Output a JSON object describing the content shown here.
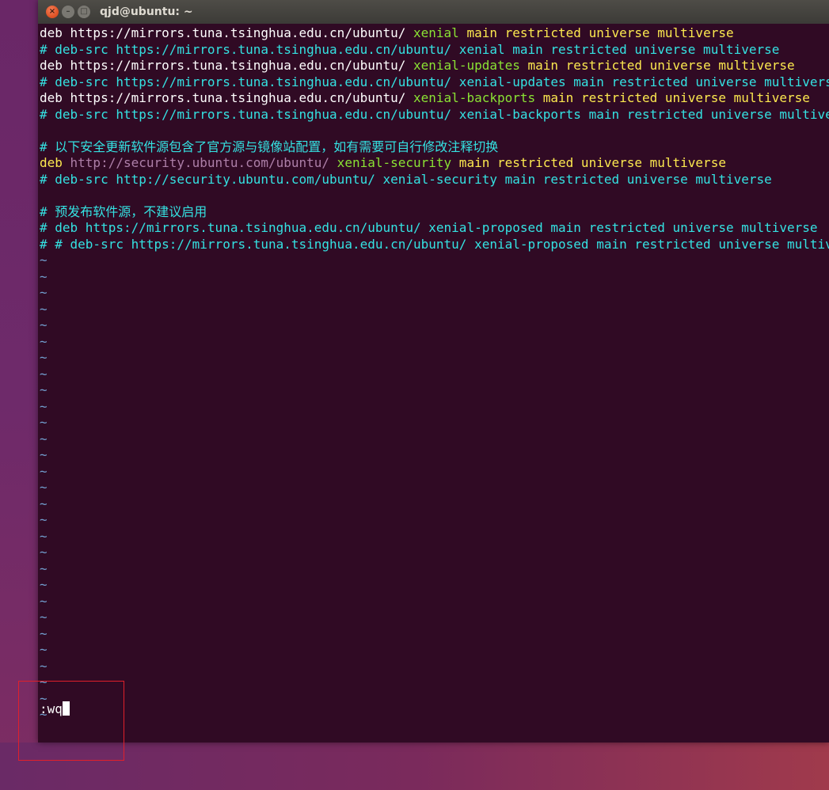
{
  "window": {
    "title": "qjd@ubuntu: ~",
    "buttons": {
      "close": "×",
      "minimize": "–",
      "maximize": "□"
    }
  },
  "terminal": {
    "lines": [
      [
        {
          "t": "deb https://mirrors.tuna.tsinghua.edu.cn/ubuntu/ ",
          "c": "w"
        },
        {
          "t": "xenial",
          "c": "g"
        },
        {
          "t": " main restricted universe multiverse",
          "c": "k"
        }
      ],
      [
        {
          "t": "# deb-src https://mirrors.tuna.tsinghua.edu.cn/ubuntu/ xenial main restricted universe multiverse",
          "c": "c"
        }
      ],
      [
        {
          "t": "deb https://mirrors.tuna.tsinghua.edu.cn/ubuntu/ ",
          "c": "w"
        },
        {
          "t": "xenial-updates",
          "c": "g"
        },
        {
          "t": " main restricted universe multiverse",
          "c": "k"
        }
      ],
      [
        {
          "t": "# deb-src https://mirrors.tuna.tsinghua.edu.cn/ubuntu/ xenial-updates main restricted universe multiverse",
          "c": "c"
        }
      ],
      [
        {
          "t": "deb https://mirrors.tuna.tsinghua.edu.cn/ubuntu/ ",
          "c": "w"
        },
        {
          "t": "xenial-backports",
          "c": "g"
        },
        {
          "t": " main restricted universe multiverse",
          "c": "k"
        }
      ],
      [
        {
          "t": "# deb-src https://mirrors.tuna.tsinghua.edu.cn/ubuntu/ xenial-backports main restricted universe multiverse",
          "c": "c"
        }
      ],
      [
        {
          "t": "",
          "c": "w"
        }
      ],
      [
        {
          "t": "# 以下安全更新软件源包含了官方源与镜像站配置，如有需要可自行修改注释切换",
          "c": "c"
        }
      ],
      [
        {
          "t": "deb ",
          "c": "k"
        },
        {
          "t": "http://security.ubuntu.com/ubuntu/",
          "c": "m"
        },
        {
          "t": " xenial-security",
          "c": "g"
        },
        {
          "t": " main restricted universe multiverse",
          "c": "k"
        }
      ],
      [
        {
          "t": "# deb-src http://security.ubuntu.com/ubuntu/ xenial-security main restricted universe multiverse",
          "c": "c"
        }
      ],
      [
        {
          "t": "",
          "c": "w"
        }
      ],
      [
        {
          "t": "# 预发布软件源，不建议启用",
          "c": "c"
        }
      ],
      [
        {
          "t": "# deb https://mirrors.tuna.tsinghua.edu.cn/ubuntu/ xenial-proposed main restricted universe multiverse",
          "c": "c"
        }
      ],
      [
        {
          "t": "# # deb-src https://mirrors.tuna.tsinghua.edu.cn/ubuntu/ xenial-proposed main restricted universe multiverse",
          "c": "c"
        }
      ]
    ],
    "tilde": "~",
    "tilde_count": 29,
    "command": ":wq"
  },
  "colors": {
    "terminal_bg": "#300a24",
    "highlight_box": "#e0202a"
  }
}
